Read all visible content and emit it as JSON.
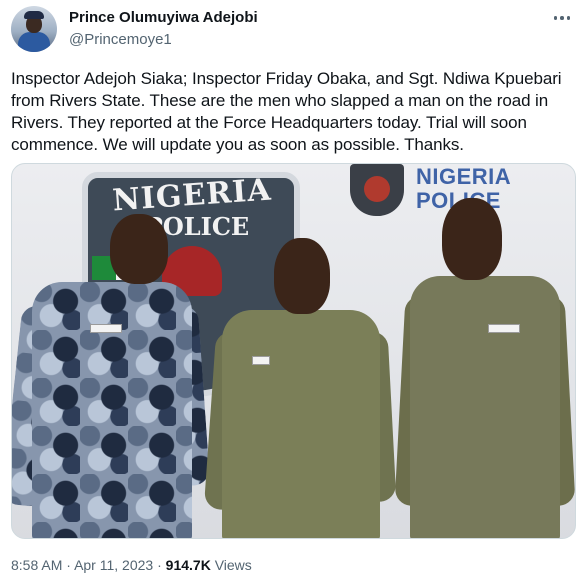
{
  "author": {
    "name": "Prince Olumuyiwa Adejobi",
    "handle": "@Princemoye1",
    "avatar_icon": "profile-photo-police-officer"
  },
  "more_icon": "more-horizontal-icon",
  "tweet": {
    "text": "Inspector Adejoh Siaka; Inspector Friday Obaka, and Sgt. Ndiwa Kpuebari from Rivers State. These are the men who slapped a man on the road in Rivers. They reported at the Force Headquarters today. Trial will soon commence. We will update you as soon as possible. Thanks."
  },
  "media": {
    "backdrop_text_1": "NIGERIA",
    "backdrop_text_2": "POLICE",
    "logo_text_1": "NIGERIA",
    "logo_text_2": "POLICE",
    "badge_text": "POLICE"
  },
  "meta": {
    "time": "8:58 AM",
    "separator": "·",
    "date": "Apr 11, 2023",
    "views_count": "914.7K",
    "views_label": "Views"
  },
  "colors": {
    "text_primary": "#0f1419",
    "text_secondary": "#536471",
    "border": "#cfd9de",
    "logo_blue": "#3f63a7"
  }
}
